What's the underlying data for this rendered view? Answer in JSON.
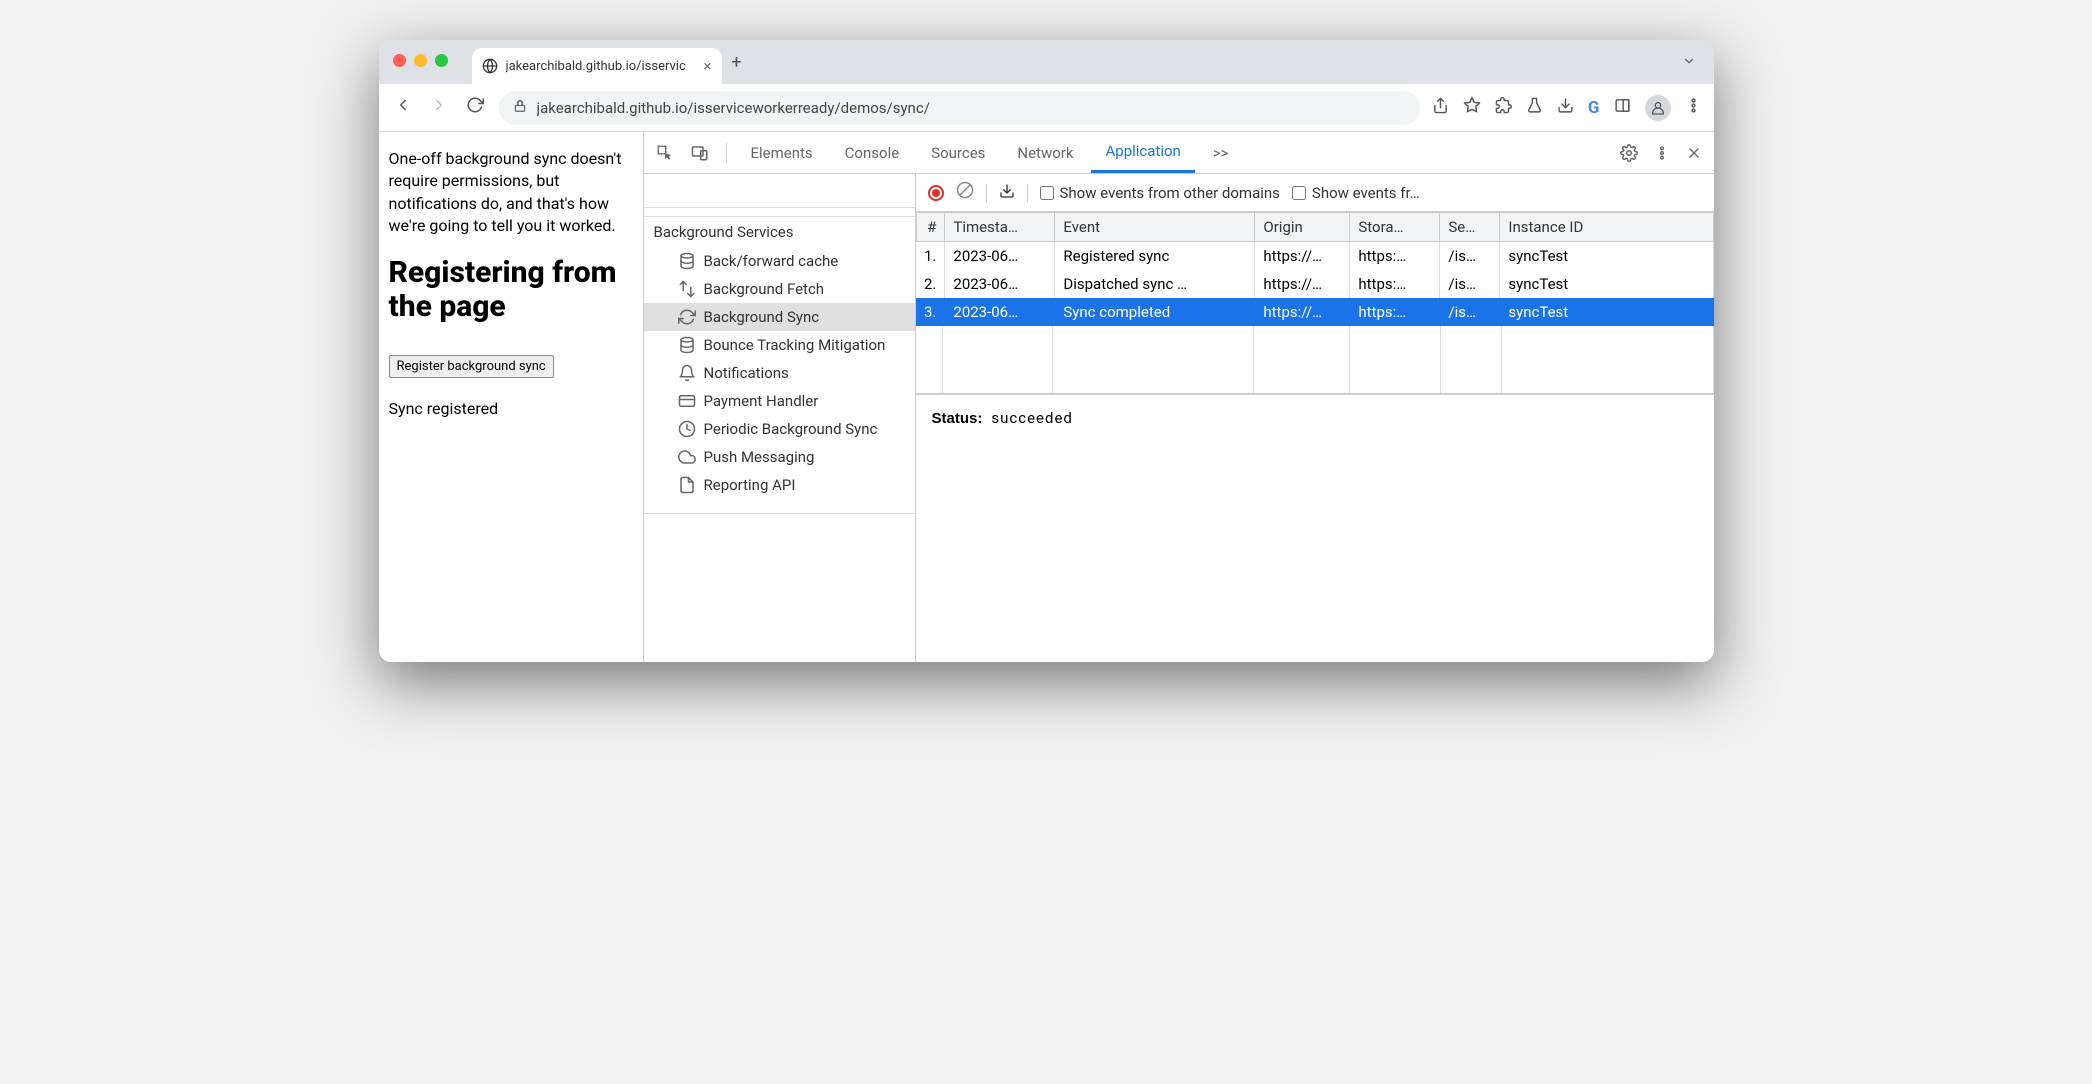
{
  "tab": {
    "title": "jakearchibald.github.io/isservic"
  },
  "toolbar": {
    "url": "jakearchibald.github.io/isserviceworkerready/demos/sync/"
  },
  "page": {
    "intro": "One-off background sync doesn't require permissions, but notifications do, and that's how we're going to tell you it worked.",
    "heading": "Registering from the page",
    "button": "Register background sync",
    "status": "Sync registered"
  },
  "devtools": {
    "tabs": [
      "Elements",
      "Console",
      "Sources",
      "Network",
      "Application"
    ],
    "active_tab": "Application",
    "more_tabs": ">>",
    "sidebar": {
      "section": "Background Services",
      "items": [
        {
          "label": "Back/forward cache",
          "icon": "database"
        },
        {
          "label": "Background Fetch",
          "icon": "updown"
        },
        {
          "label": "Background Sync",
          "icon": "sync",
          "selected": true
        },
        {
          "label": "Bounce Tracking Mitigation",
          "icon": "database"
        },
        {
          "label": "Notifications",
          "icon": "bell"
        },
        {
          "label": "Payment Handler",
          "icon": "card"
        },
        {
          "label": "Periodic Background Sync",
          "icon": "clock"
        },
        {
          "label": "Push Messaging",
          "icon": "cloud"
        },
        {
          "label": "Reporting API",
          "icon": "file"
        }
      ]
    },
    "subtoolbar": {
      "check1": "Show events from other domains",
      "check2": "Show events fr…"
    },
    "table": {
      "columns": [
        "#",
        "Timesta…",
        "Event",
        "Origin",
        "Stora…",
        "Se…",
        "Instance ID"
      ],
      "rows": [
        {
          "n": "1.",
          "ts": "2023-06…",
          "event": "Registered sync",
          "origin": "https://…",
          "storage": "https:…",
          "scope": "/is…",
          "instance": "syncTest"
        },
        {
          "n": "2.",
          "ts": "2023-06…",
          "event": "Dispatched sync …",
          "origin": "https://…",
          "storage": "https:…",
          "scope": "/is…",
          "instance": "syncTest"
        },
        {
          "n": "3.",
          "ts": "2023-06…",
          "event": "Sync completed",
          "origin": "https://…",
          "storage": "https:…",
          "scope": "/is…",
          "instance": "syncTest",
          "selected": true
        }
      ]
    },
    "status": {
      "label": "Status:",
      "value": "succeeded"
    }
  }
}
